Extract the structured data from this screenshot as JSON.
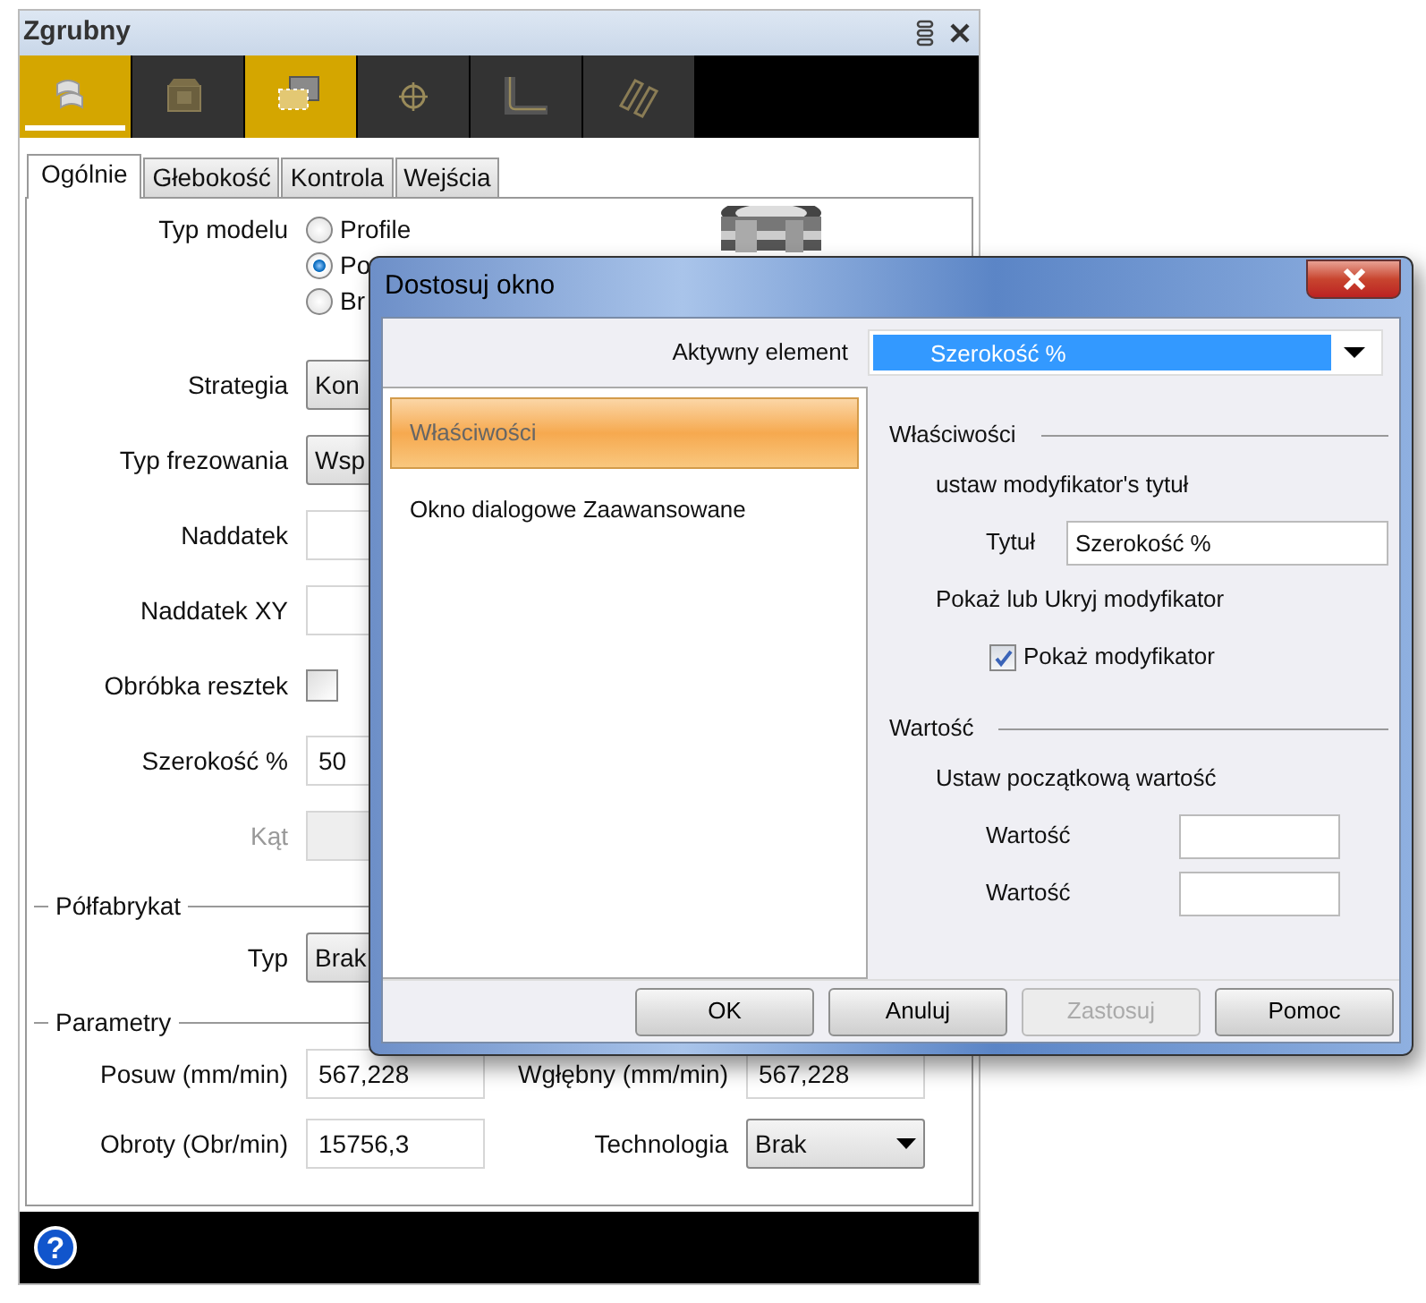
{
  "panel": {
    "title": "Zgrubny",
    "tools": [
      {
        "selected": true,
        "highlighted": true
      },
      {
        "selected": false,
        "highlighted": false
      },
      {
        "selected": false,
        "highlighted": true
      },
      {
        "selected": false,
        "highlighted": false
      },
      {
        "selected": false,
        "highlighted": false
      },
      {
        "selected": false,
        "highlighted": false
      }
    ],
    "tabs": [
      {
        "label": "Ogólnie",
        "selected": true
      },
      {
        "label": "Głebokość",
        "selected": false
      },
      {
        "label": "Kontrola",
        "selected": false
      },
      {
        "label": "Wejścia",
        "selected": false
      }
    ],
    "form": [
      {
        "kind": "radio",
        "label": "Typ modelu",
        "options": [
          {
            "label": "Profile",
            "selected": false
          },
          {
            "label": "Po",
            "selected": true
          },
          {
            "label": "Br",
            "selected": false
          }
        ]
      },
      {
        "kind": "combo",
        "label": "Strategia",
        "value": "Kon"
      },
      {
        "kind": "combo",
        "label": "Typ frezowania",
        "value": "Wsp"
      },
      {
        "kind": "text",
        "label": "Naddatek"
      },
      {
        "kind": "text",
        "label": "Naddatek XY"
      },
      {
        "kind": "checkbox",
        "label": "Obróbka resztek",
        "checked": false
      },
      {
        "kind": "text",
        "label": "Szerokość %",
        "value": "50"
      },
      {
        "kind": "text",
        "label": "Kąt",
        "disabled": true
      },
      {
        "kind": "section",
        "label": "Półfabrykat"
      },
      {
        "kind": "combo",
        "label": "Typ",
        "value": "Brak"
      },
      {
        "kind": "section",
        "label": "Parametry"
      }
    ],
    "params": [
      {
        "cells": [
          {
            "kind": "text",
            "label": "Posuw (mm/min)",
            "value": "567,228"
          },
          {
            "kind": "text",
            "label": "Wgłębny (mm/min)",
            "value": "567,228"
          }
        ]
      },
      {
        "cells": [
          {
            "kind": "text",
            "label": "Obroty (Obr/min)",
            "value": "15756,3"
          },
          {
            "kind": "combo",
            "label": "Technologia",
            "value": "Brak"
          }
        ]
      }
    ],
    "help": "?"
  },
  "dialog": {
    "title": "Dostosuj okno",
    "active_label": "Aktywny element",
    "active_value": "Szerokość %",
    "pages": [
      {
        "label": "Właściwości",
        "selected": true
      },
      {
        "label": "Okno dialogowe Zaawansowane",
        "selected": false
      }
    ],
    "groups": [
      {
        "title": "Właściwości",
        "items": [
          {
            "kind": "note",
            "text": "ustaw modyfikator's tytuł"
          },
          {
            "kind": "field",
            "label": "Tytuł",
            "value": "Szerokość %"
          },
          {
            "kind": "note",
            "text": "Pokaż lub Ukryj modyfikator"
          },
          {
            "kind": "checkbox",
            "label": "Pokaż modyfikator",
            "checked": true
          }
        ]
      },
      {
        "title": "Wartość",
        "items": [
          {
            "kind": "note",
            "text": "Ustaw początkową wartość"
          },
          {
            "kind": "field",
            "label": "Wartość"
          },
          {
            "kind": "field",
            "label": "Wartość"
          }
        ]
      }
    ],
    "buttons": [
      {
        "label": "OK",
        "disabled": false
      },
      {
        "label": "Anuluj",
        "disabled": false
      },
      {
        "label": "Zastosuj",
        "disabled": true
      },
      {
        "label": "Pomoc",
        "disabled": false
      }
    ]
  }
}
